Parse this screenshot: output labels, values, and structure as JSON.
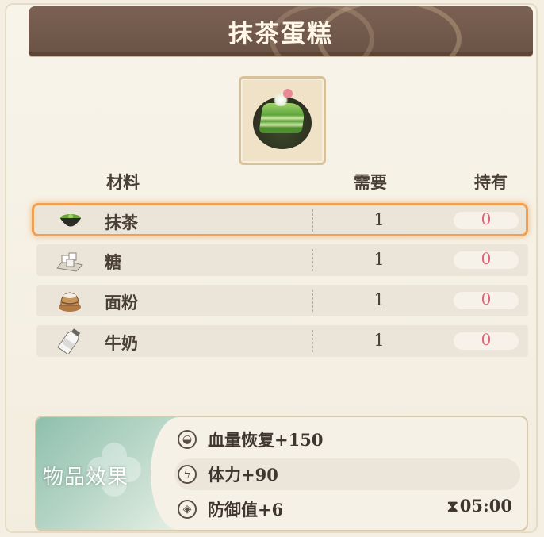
{
  "title": "抹茶蛋糕",
  "dish_icon": "matcha-cake-icon",
  "headers": {
    "material": "材料",
    "need": "需要",
    "have": "持有"
  },
  "materials": [
    {
      "name": "抹茶",
      "icon": "matcha-bowl-icon",
      "need": "1",
      "have": "0",
      "selected": true
    },
    {
      "name": "糖",
      "icon": "sugar-cubes-icon",
      "need": "1",
      "have": "0",
      "selected": false
    },
    {
      "name": "面粉",
      "icon": "flour-sack-icon",
      "need": "1",
      "have": "0",
      "selected": false
    },
    {
      "name": "牛奶",
      "icon": "milk-bottle-icon",
      "need": "1",
      "have": "0",
      "selected": false
    }
  ],
  "effects": {
    "label": "物品效果",
    "items": [
      {
        "text": "血量恢复+150",
        "icon": "heal-icon"
      },
      {
        "text": "体力+90",
        "icon": "stamina-icon"
      },
      {
        "text": "防御值+6",
        "icon": "defense-icon"
      }
    ],
    "timer": "05:00",
    "timer_icon": "hourglass-icon"
  },
  "colors": {
    "title_bar": "#6f5649",
    "selected_border": "#f0a050",
    "have_value": "#e0647a",
    "effects_panel": "#8fbfae"
  }
}
